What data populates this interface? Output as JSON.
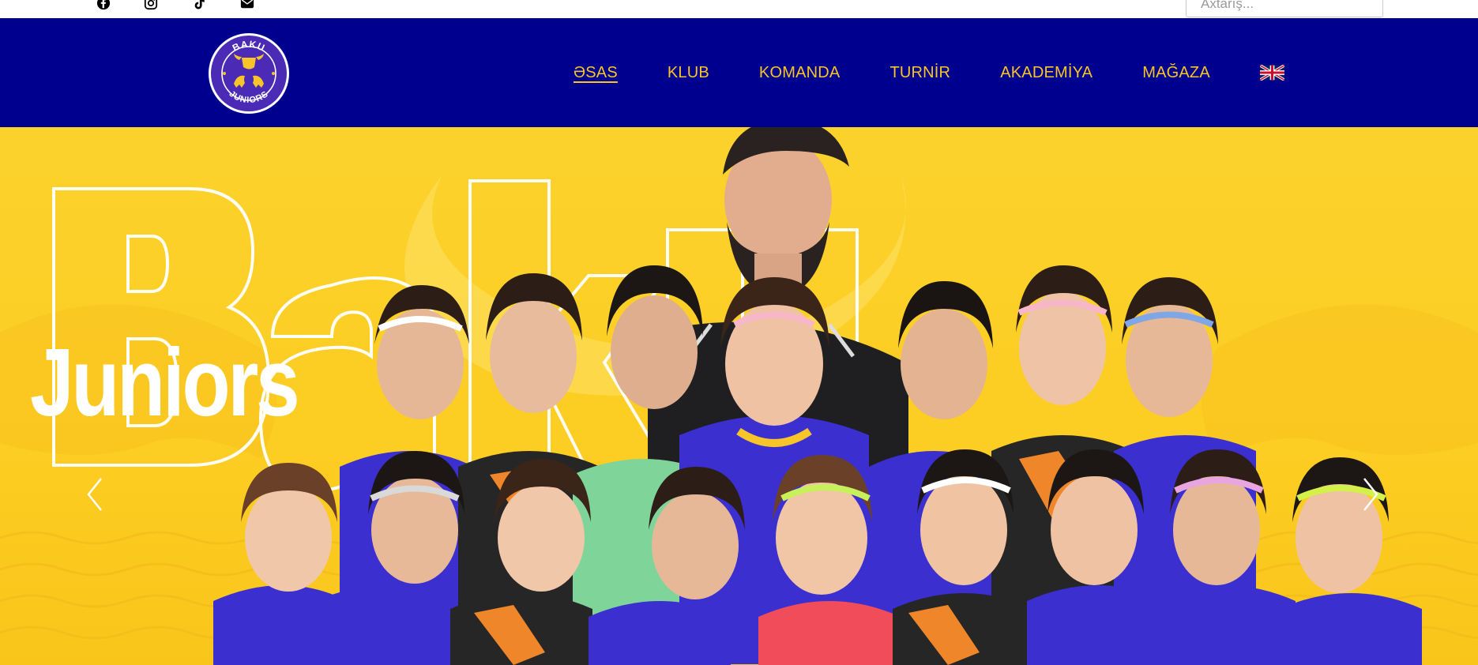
{
  "topbar": {
    "social_icons": [
      "facebook-icon",
      "instagram-icon",
      "tiktok-icon",
      "email-icon"
    ],
    "search_placeholder": "Axtarış..."
  },
  "header": {
    "logo": {
      "text_top": "BAKU",
      "text_bottom": "JUNIORS"
    },
    "nav": [
      {
        "label": "ƏSAS",
        "active": true
      },
      {
        "label": "KLUB",
        "active": false
      },
      {
        "label": "KOMANDA",
        "active": false
      },
      {
        "label": "TURNİR",
        "active": false
      },
      {
        "label": "AKADEMİYA",
        "active": false
      },
      {
        "label": "MAĞAZA",
        "active": false
      }
    ],
    "language_icon": "uk-flag-icon"
  },
  "hero": {
    "big_outline_text": "Baku",
    "overlay_text": "Juniors",
    "prev_icon": "chevron-left-icon",
    "next_icon": "chevron-right-icon"
  },
  "colors": {
    "header_bg": "#00008f",
    "nav_text": "#f7c42a",
    "hero_yellow": "#fccd22",
    "jersey_blue": "#3b2fd0",
    "jersey_orange": "#f0862a"
  }
}
